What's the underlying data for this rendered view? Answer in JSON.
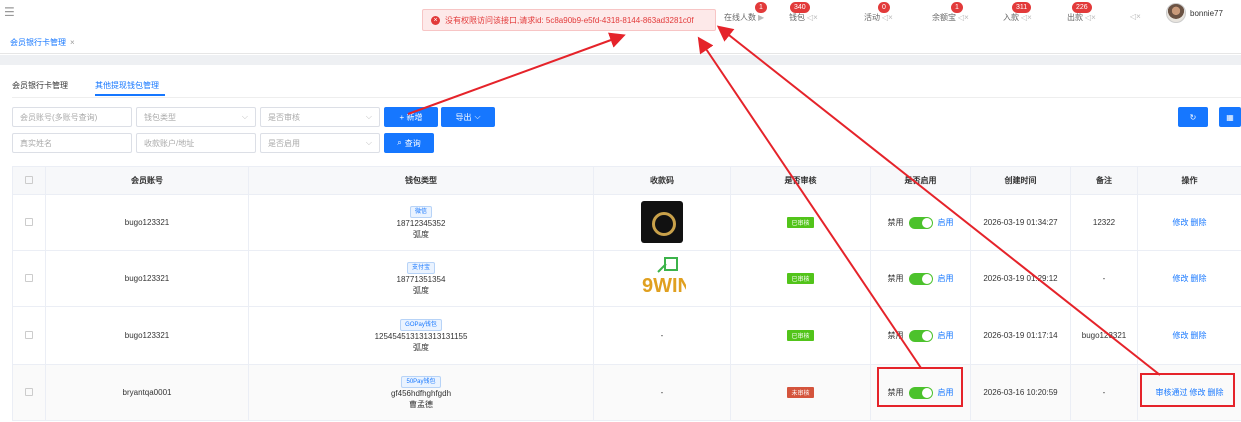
{
  "topbar": {
    "stats": [
      {
        "label": "在线人数",
        "badge": "1"
      },
      {
        "label": "钱包",
        "badge": "340"
      },
      {
        "label": "活动",
        "badge": "0"
      },
      {
        "label": "余额宝",
        "badge": "1"
      },
      {
        "label": "入款",
        "badge": "311"
      },
      {
        "label": "出款",
        "badge": "226"
      }
    ],
    "username": "bonnie77"
  },
  "tabbar": {
    "active_tab": "会员银行卡管理",
    "close": "×"
  },
  "toast": {
    "message": "没有权限访问该接口,请求id: 5c8a90b9-e5fd-4318-8144-863ad3281c0f"
  },
  "subtabs": {
    "first": "会员银行卡管理",
    "second": "其他提现钱包管理"
  },
  "filters": {
    "member_account_placeholder": "会员账号(多账号查询)",
    "wallet_type_placeholder": "钱包类型",
    "review_placeholder": "是否审核",
    "real_name_placeholder": "真实姓名",
    "payee_account_placeholder": "收款账户/地址",
    "enabled_placeholder": "是否启用",
    "add_label": "+ 新增",
    "export_label": "导出",
    "query_label": "查询"
  },
  "table": {
    "headers": [
      "会员账号",
      "钱包类型",
      "收款码",
      "是否审核",
      "是否启用",
      "创建时间",
      "备注",
      "操作"
    ],
    "rows": [
      {
        "account": "bugo123321",
        "wallet_tag": "微信",
        "wallet_no": "18712345352",
        "wallet_name": "弧度",
        "qr": "dark-logo",
        "review": "已审核",
        "review_ok": true,
        "disable_label": "禁用",
        "enable_label": "启用",
        "created": "2026-03-19 01:34:27",
        "remark": "12322",
        "ops": [
          "修改",
          "删除"
        ]
      },
      {
        "account": "bugo123321",
        "wallet_tag": "支付宝",
        "wallet_no": "18771351354",
        "wallet_name": "弧度",
        "qr": "9WIN",
        "review": "已审核",
        "review_ok": true,
        "disable_label": "禁用",
        "enable_label": "启用",
        "created": "2026-03-19 01:29:12",
        "remark": "-",
        "ops": [
          "修改",
          "删除"
        ]
      },
      {
        "account": "bugo123321",
        "wallet_tag": "GOPay钱包",
        "wallet_no": "125454513131313131155",
        "wallet_name": "弧度",
        "qr": "-",
        "review": "已审核",
        "review_ok": true,
        "disable_label": "禁用",
        "enable_label": "启用",
        "created": "2026-03-19 01:17:14",
        "remark": "bugo123321",
        "ops": [
          "修改",
          "删除"
        ]
      },
      {
        "account": "bryantqa0001",
        "wallet_tag": "50Pay钱包",
        "wallet_no": "gf456hdfhghfgdh",
        "wallet_name": "曹孟德",
        "qr": "-",
        "review": "未审核",
        "review_ok": false,
        "disable_label": "禁用",
        "enable_label": "启用",
        "created": "2026-03-16 10:20:59",
        "remark": "-",
        "ops": [
          "审核通过",
          "修改",
          "删除"
        ]
      }
    ]
  },
  "colors": {
    "accent": "#1677ff",
    "error": "#e23a3a",
    "toggle_on": "#4cc22c",
    "annotation": "#e5232a",
    "account_text": "#c23b3b"
  }
}
